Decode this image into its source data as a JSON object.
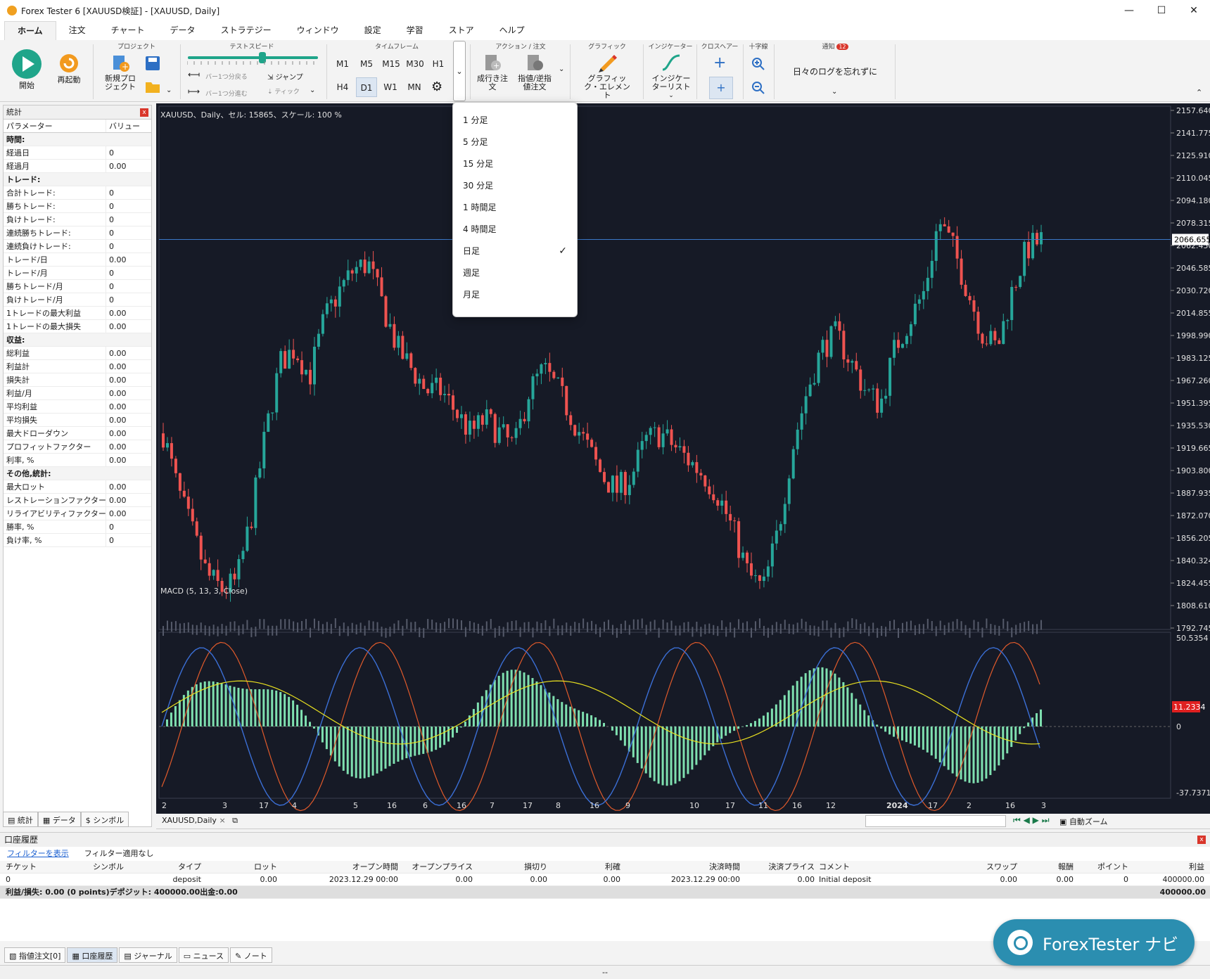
{
  "window": {
    "title": "Forex Tester 6  [XAUUSD検証] - [XAUUSD, Daily]",
    "minimize": "—",
    "maximize": "☐",
    "close": "✕"
  },
  "menu": {
    "tabs": [
      "ホーム",
      "注文",
      "チャート",
      "データ",
      "ストラテジー",
      "ウィンドウ",
      "設定",
      "学習",
      "ストア",
      "ヘルプ"
    ],
    "active": "ホーム"
  },
  "ribbon": {
    "start": "開始",
    "restart": "再起動",
    "project_group": "プロジェクト",
    "new_project": "新規プロジェクト",
    "test_speed_group": "テストスピード",
    "bar_back": "バー1つ分戻る",
    "bar_forward": "バー1つ分進む",
    "jump": "ジャンプ",
    "tick": "ティック",
    "timeframe_group": "タイムフレーム",
    "timeframes_row1": [
      "M1",
      "M5",
      "M15",
      "M30",
      "H1"
    ],
    "timeframes_row2": [
      "H4",
      "D1",
      "W1",
      "MN"
    ],
    "selected_timeframe": "D1",
    "action_group": "アクション / 注文",
    "market_order": "成行き注文",
    "limit_order": "指値/逆指値注文",
    "graphic_group": "グラフィック",
    "graphic_elements": "グラフィック・エレメント",
    "indicator_group": "インジケーター",
    "indicator_list": "インジケーターリスト",
    "crosshair_group": "クロスヘアー",
    "cross_group": "十字線",
    "notify_group": "通知",
    "notify_count": "12",
    "notify_text": "日々のログを忘れずに"
  },
  "timeframe_menu": {
    "items": [
      "1 分足",
      "5 分足",
      "15 分足",
      "30 分足",
      "1 時間足",
      "4 時間足",
      "日足",
      "週足",
      "月足"
    ],
    "checked": "日足"
  },
  "stats_panel": {
    "title": "統計",
    "col_param": "パラメーター",
    "col_value": "バリュー",
    "rows": [
      {
        "section": "時間:"
      },
      {
        "p": "経過日",
        "v": "0"
      },
      {
        "p": "経過月",
        "v": "0.00"
      },
      {
        "section": "トレード:"
      },
      {
        "p": "合計トレード:",
        "v": "0"
      },
      {
        "p": "勝ちトレード:",
        "v": "0"
      },
      {
        "p": "負けトレード:",
        "v": "0"
      },
      {
        "p": "連続勝ちトレード:",
        "v": "0"
      },
      {
        "p": "連続負けトレード:",
        "v": "0"
      },
      {
        "p": "トレード/日",
        "v": "0.00"
      },
      {
        "p": "トレード/月",
        "v": "0"
      },
      {
        "p": "勝ちトレード/月",
        "v": "0"
      },
      {
        "p": "負けトレード/月",
        "v": "0"
      },
      {
        "p": "1トレードの最大利益",
        "v": "0.00"
      },
      {
        "p": "1トレードの最大損失",
        "v": "0.00"
      },
      {
        "section": "収益:"
      },
      {
        "p": "総利益",
        "v": "0.00"
      },
      {
        "p": "利益計",
        "v": "0.00"
      },
      {
        "p": "損失計",
        "v": "0.00"
      },
      {
        "p": "利益/月",
        "v": "0.00"
      },
      {
        "p": "平均利益",
        "v": "0.00"
      },
      {
        "p": "平均損失",
        "v": "0.00"
      },
      {
        "p": "最大ドローダウン",
        "v": "0.00"
      },
      {
        "p": "プロフィットファクター",
        "v": "0.00"
      },
      {
        "p": "利率, %",
        "v": "0.00"
      },
      {
        "section": "その他,統計:"
      },
      {
        "p": "最大ロット",
        "v": "0.00"
      },
      {
        "p": "レストレーションファクター",
        "v": "0.00"
      },
      {
        "p": "リライアビリティファクター",
        "v": "0.00"
      },
      {
        "p": "勝率, %",
        "v": "0"
      },
      {
        "p": "負け率, %",
        "v": "0"
      }
    ],
    "tabs": [
      "統計",
      "データ",
      "シンボル"
    ]
  },
  "chart": {
    "header": "XAUUSD、Daily、セル: 15865、スケール: 100 %",
    "tab_label": "XAUUSD,Daily",
    "current_price": "2066.655",
    "price_ticks": [
      "2157.640",
      "2141.775",
      "2125.910",
      "2110.045",
      "2094.180",
      "2078.315",
      "2062.450",
      "2046.585",
      "2030.720",
      "2014.855",
      "1998.990",
      "1983.125",
      "1967.260",
      "1951.395",
      "1935.530",
      "1919.665",
      "1903.800",
      "1887.935",
      "1872.070",
      "1856.205",
      "1840.324",
      "1824.455",
      "1808.610",
      "1792.745"
    ],
    "macd_label": "MACD (5, 13, 3, Close)",
    "macd_ticks": [
      "50.5354",
      "0",
      "-37.7371"
    ],
    "macd_current": "11.2334",
    "date_ticks": [
      "2",
      "3",
      "17",
      "4",
      "5",
      "16",
      "6",
      "16",
      "7",
      "17",
      "8",
      "16",
      "9",
      "10",
      "17",
      "11",
      "16",
      "12",
      "2024",
      "17",
      "2",
      "16",
      "3"
    ],
    "auto_zoom": "自動ズーム",
    "colors": {
      "bg": "#161a26",
      "up": "#26a69a",
      "down": "#ef5350",
      "macd_blue": "#3b6fd6",
      "macd_red": "#e05a2b",
      "signal": "#e8e020",
      "hist": "#7fe0b0"
    }
  },
  "account_history": {
    "title": "口座履歴",
    "filter_link": "フィルターを表示",
    "filter_status": "フィルター適用なし",
    "columns": [
      "チケット",
      "シンボル",
      "タイプ",
      "ロット",
      "オープン時間",
      "オープンプライス",
      "損切り",
      "利確",
      "決済時間",
      "決済プライス",
      "コメント",
      "スワップ",
      "報酬",
      "ポイント",
      "利益"
    ],
    "row": [
      "0",
      "",
      "deposit",
      "0.00",
      "2023.12.29 00:00",
      "0.00",
      "0.00",
      "0.00",
      "2023.12.29 00:00",
      "0.00",
      "Initial deposit",
      "0.00",
      "0.00",
      "0",
      "400000.00"
    ],
    "total_label": "利益/損失: 0.00 (0 points)デポジット: 400000.00出金:0.00",
    "total_value": "400000.00"
  },
  "bottom_tabs": [
    "指値注文[0]",
    "口座履歴",
    "ジャーナル",
    "ニュース",
    "ノート"
  ],
  "status_text": "--",
  "navi_badge": "ForexTester ナビ"
}
